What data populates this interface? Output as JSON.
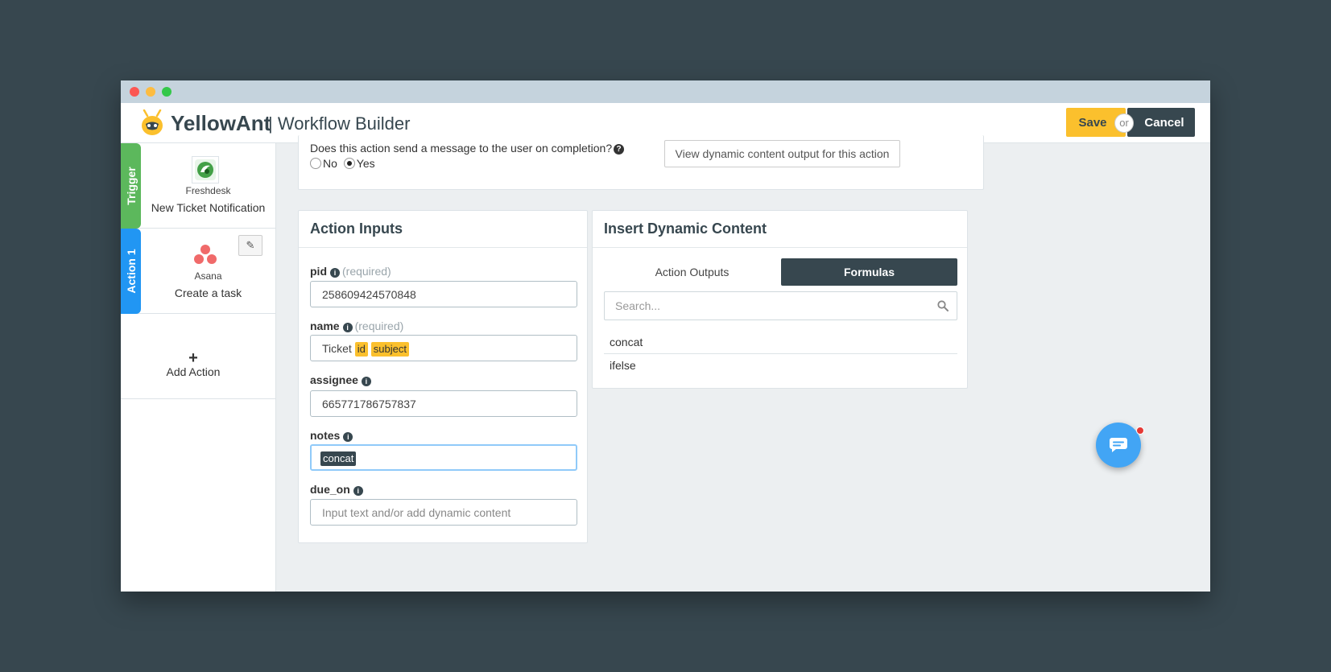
{
  "header": {
    "brand": "YellowAnt",
    "subtitle": "| Workflow Builder",
    "save_label": "Save",
    "or_label": "or",
    "cancel_label": "Cancel"
  },
  "sidebar": {
    "trigger": {
      "tab_label": "Trigger",
      "app_name": "Freshdesk",
      "action": "New Ticket Notification"
    },
    "action1": {
      "tab_label": "Action 1",
      "app_name": "Asana",
      "action": "Create a task"
    },
    "add_action": {
      "plus": "+",
      "label": "Add Action"
    }
  },
  "completion": {
    "question": "Does this action send a message to the user on completion?",
    "options": {
      "no": "No",
      "yes": "Yes"
    },
    "selected": "Yes",
    "view_output_button": "View dynamic content output for this action"
  },
  "action_inputs": {
    "title": "Action Inputs",
    "required_label": "(required)",
    "fields": {
      "pid": {
        "label": "pid",
        "value": "258609424570848"
      },
      "name": {
        "label": "name",
        "prefix": "Ticket",
        "tokens": [
          "id",
          "subject"
        ]
      },
      "assignee": {
        "label": "assignee",
        "value": "665771786757837"
      },
      "notes": {
        "label": "notes",
        "token": "concat"
      },
      "due_on": {
        "label": "due_on",
        "placeholder": "Input text and/or add dynamic content"
      }
    }
  },
  "dynamic_content": {
    "title": "Insert Dynamic Content",
    "tabs": [
      "Action Outputs",
      "Formulas"
    ],
    "active_tab": "Formulas",
    "search_placeholder": "Search...",
    "formulas": [
      "concat",
      "ifelse"
    ]
  },
  "colors": {
    "accent_yellow": "#fbc02d",
    "dark": "#37474f",
    "trigger_green": "#5cb85c",
    "action_blue": "#2196f3",
    "chat_blue": "#42a5f5"
  }
}
